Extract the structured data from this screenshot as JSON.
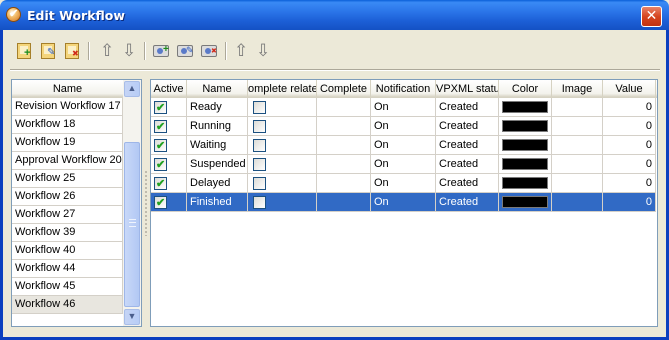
{
  "window": {
    "title": "Edit Workflow"
  },
  "toolbar": {
    "buttons": [
      {
        "name": "new-workflow-button",
        "icon": "doc-plus-icon"
      },
      {
        "name": "edit-workflow-button",
        "icon": "doc-edit-icon"
      },
      {
        "name": "delete-workflow-button",
        "icon": "doc-delete-icon"
      },
      {
        "name": "move-up-button",
        "icon": "arrow-up-icon"
      },
      {
        "name": "move-down-button",
        "icon": "arrow-down-icon"
      },
      {
        "name": "new-status-button",
        "icon": "status-add-icon"
      },
      {
        "name": "edit-status-button",
        "icon": "status-edit-icon"
      },
      {
        "name": "delete-status-button",
        "icon": "status-delete-icon"
      },
      {
        "name": "status-up-button",
        "icon": "arrow-up-icon"
      },
      {
        "name": "status-down-button",
        "icon": "arrow-down-icon"
      }
    ],
    "arrow_up": "⇧",
    "arrow_down": "⇩"
  },
  "workflow_list": {
    "header": "Name",
    "items": [
      "Revision Workflow 17",
      "Workflow 18",
      "Workflow 19",
      "Approval Workflow 20",
      "Workflow 25",
      "Workflow 26",
      "Workflow 27",
      "Workflow 39",
      "Workflow 40",
      "Workflow 44",
      "Workflow 45",
      "Workflow 46"
    ],
    "selected_index": 11,
    "scroll_up": "▲",
    "scroll_down": "▼"
  },
  "status_grid": {
    "columns": [
      "Active",
      "Name",
      "omplete relate",
      "Complete",
      "Notification",
      "VPXML statu",
      "Color",
      "Image",
      "Value"
    ],
    "rows": [
      {
        "active": true,
        "name": "Ready",
        "complete_related": false,
        "complete": "",
        "notification": "On",
        "vpxml_status": "Created",
        "color": "#000000",
        "image": "",
        "value": "0"
      },
      {
        "active": true,
        "name": "Running",
        "complete_related": false,
        "complete": "",
        "notification": "On",
        "vpxml_status": "Created",
        "color": "#000000",
        "image": "",
        "value": "0"
      },
      {
        "active": true,
        "name": "Waiting",
        "complete_related": false,
        "complete": "",
        "notification": "On",
        "vpxml_status": "Created",
        "color": "#000000",
        "image": "",
        "value": "0"
      },
      {
        "active": true,
        "name": "Suspended",
        "complete_related": false,
        "complete": "",
        "notification": "On",
        "vpxml_status": "Created",
        "color": "#000000",
        "image": "",
        "value": "0"
      },
      {
        "active": true,
        "name": "Delayed",
        "complete_related": false,
        "complete": "",
        "notification": "On",
        "vpxml_status": "Created",
        "color": "#000000",
        "image": "",
        "value": "0"
      },
      {
        "active": true,
        "name": "Finished",
        "complete_related": false,
        "complete": "",
        "notification": "On",
        "vpxml_status": "Created",
        "color": "#000000",
        "image": "",
        "value": "0"
      }
    ],
    "selected_index": 5
  },
  "colors": {
    "title_bar": "#2a74e8",
    "selection": "#316ac5",
    "dialog_bg": "#ece9d8"
  }
}
